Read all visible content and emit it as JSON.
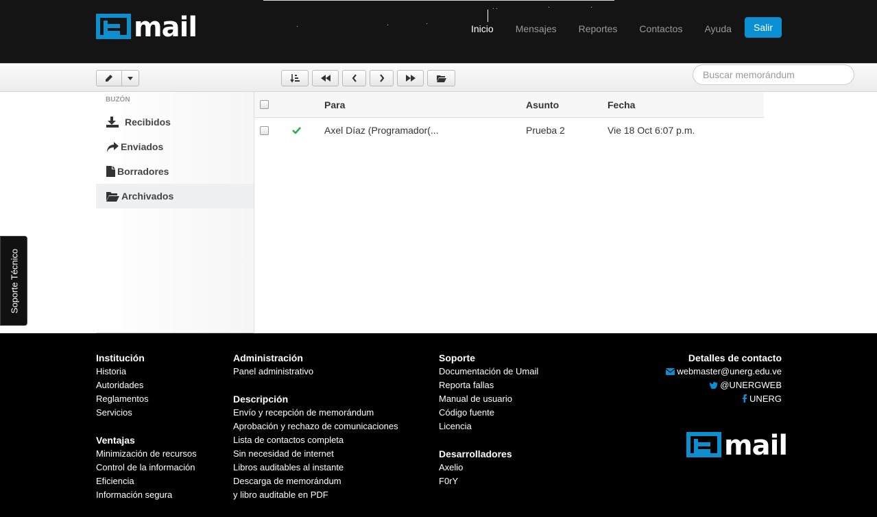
{
  "brand": {
    "logo_text": "mail",
    "accent": "#0c8ecf"
  },
  "nav": {
    "items": [
      {
        "label": "Inicio",
        "active": true
      },
      {
        "label": "Mensajes"
      },
      {
        "label": "Reportes"
      },
      {
        "label": "Contactos"
      },
      {
        "label": "Ayuda"
      }
    ],
    "logout_label": "Salir"
  },
  "toolbar": {
    "search_placeholder": "Buscar memorándum",
    "buttons": [
      "pencil-icon",
      "caret-down-icon",
      "sort-icon",
      "fast-backward-icon",
      "chevron-left-icon",
      "chevron-right-icon",
      "fast-forward-icon",
      "folder-open-icon"
    ]
  },
  "sidebar": {
    "header": "Buzón",
    "items": [
      {
        "label": "Recibidos",
        "icon": "download-icon"
      },
      {
        "label": "Enviados",
        "icon": "share-icon"
      },
      {
        "label": "Borradores",
        "icon": "file-icon"
      },
      {
        "label": "Archivados",
        "icon": "folder-open-icon",
        "active": true
      }
    ]
  },
  "table": {
    "columns": [
      "Para",
      "Asunto",
      "Fecha"
    ],
    "rows": [
      {
        "status": "check-icon",
        "para": "Axel Díaz (Programador(...",
        "asunto": "Prueba 2",
        "fecha": "Vie 18 Oct 6:07 p.m."
      }
    ]
  },
  "soporte_tab": "Soporte Técnico",
  "footer": {
    "institucion": {
      "title": "Institución",
      "items": [
        "Historia",
        "Autoridades",
        "Reglamentos",
        "Servicios"
      ]
    },
    "ventajas": {
      "title": "Ventajas",
      "items": [
        "Minimización de recursos",
        "Control de la información",
        "Eficiencia",
        "Información segura"
      ]
    },
    "administracion": {
      "title": "Administración",
      "items": [
        "Panel administrativo"
      ]
    },
    "descripcion": {
      "title": "Descripción",
      "items": [
        "Envío y recepción de memorándum",
        "Aprobación y rechazo de comunicaciones",
        "Lista de contactos completa",
        "Sin necesidad de internet",
        "Libros auditables al instante",
        "Descarga de memorándum",
        "y libro auditable en PDF"
      ]
    },
    "soporte": {
      "title": "Soporte",
      "items": [
        "Documentación de Umail",
        "Reporta fallas",
        "Manual de usuario",
        "Código fuente",
        "Licencia"
      ]
    },
    "desarrolladores": {
      "title": "Desarrolladores",
      "items": [
        "Axelio",
        "F0rY"
      ]
    },
    "contacto": {
      "title": "Detalles de contacto",
      "email": "webmaster@unerg.edu.ve",
      "twitter": "@UNERGWEB",
      "facebook": "UNERG"
    }
  }
}
